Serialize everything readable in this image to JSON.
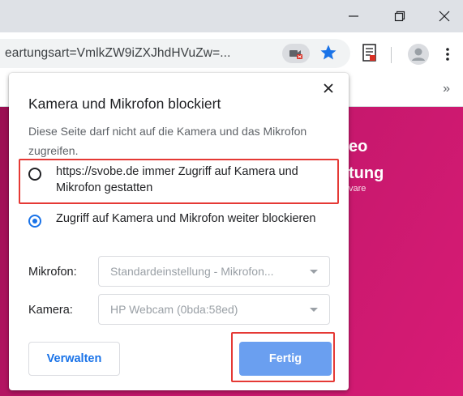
{
  "browser": {
    "url": "eartungsart=VmlkZW9iZXJhdHVuZw=...",
    "icons": {
      "minimize": "minimize-icon",
      "restore": "restore-icon",
      "close": "close-window-icon",
      "camera_blocked": "camera-blocked-icon",
      "bookmark": "star-icon",
      "extension": "document-extension-icon",
      "profile": "avatar-icon",
      "menu": "kebab-menu-icon",
      "bookmarks_more": "double-chevron-icon"
    },
    "bookmarks_more_label": "»"
  },
  "background": {
    "line1": "eo",
    "line2": "tung",
    "line3": "vare"
  },
  "dialog": {
    "title": "Kamera und Mikrofon blockiert",
    "description": "Diese Seite darf nicht auf die Kamera und das Mikrofon zugreifen.",
    "options": [
      {
        "label": "https://svobe.de immer Zugriff auf Kamera und Mikrofon gestatten",
        "selected": false
      },
      {
        "label": "Zugriff auf Kamera und Mikrofon weiter blockieren",
        "selected": true
      }
    ],
    "microphone": {
      "label": "Mikrofon:",
      "value": "Standardeinstellung - Mikrofon..."
    },
    "camera": {
      "label": "Kamera:",
      "value": "HP Webcam (0bda:58ed)"
    },
    "manage_label": "Verwalten",
    "done_label": "Fertig",
    "close_icon": "close-icon"
  },
  "colors": {
    "accent": "#1a73e8",
    "done_button": "#6a9ff0",
    "highlight": "#e53935",
    "page_bg": "#c0176a"
  }
}
